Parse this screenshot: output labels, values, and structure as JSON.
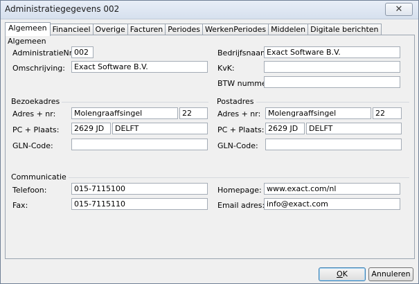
{
  "window": {
    "title": "Administratiegegevens 002",
    "close_glyph": "✕"
  },
  "tabs": [
    {
      "label": "Algemeen",
      "active": true
    },
    {
      "label": "Financieel"
    },
    {
      "label": "Overige"
    },
    {
      "label": "Facturen"
    },
    {
      "label": "Periodes"
    },
    {
      "label": "WerkenPeriodes"
    },
    {
      "label": "Middelen"
    },
    {
      "label": "Digitale berichten"
    }
  ],
  "algemeen": {
    "group_title": "Algemeen",
    "administratienr_label": "AdministratieNr:",
    "administratienr_value": "002",
    "omschrijving_label": "Omschrijving:",
    "omschrijving_value": "Exact Software B.V.",
    "bedrijfsnaam_label": "Bedrijfsnaam:",
    "bedrijfsnaam_value": "Exact Software B.V.",
    "kvk_label": "KvK:",
    "kvk_value": "",
    "btw_label": "BTW nummer:",
    "btw_value": ""
  },
  "bezoekadres": {
    "group_title": "Bezoekadres",
    "adres_label": "Adres + nr:",
    "street": "Molengraaffsingel",
    "number": "22",
    "pc_label": "PC + Plaats:",
    "postcode": "2629 JD",
    "city": "DELFT",
    "gln_label": "GLN-Code:",
    "gln_value": ""
  },
  "postadres": {
    "group_title": "Postadres",
    "adres_label": "Adres + nr:",
    "street": "Molengraaffsingel",
    "number": "22",
    "pc_label": "PC + Plaats:",
    "postcode": "2629 JD",
    "city": "DELFT",
    "gln_label": "GLN-Code:",
    "gln_value": ""
  },
  "communicatie": {
    "group_title": "Communicatie",
    "telefoon_label": "Telefoon:",
    "telefoon_value": "015-7115100",
    "fax_label": "Fax:",
    "fax_value": "015-7115110",
    "homepage_label": "Homepage:",
    "homepage_value": "www.exact.com/nl",
    "email_label": "Email adres:",
    "email_value": "info@exact.com"
  },
  "buttons": {
    "ok_mnemonic": "O",
    "ok_rest": "K",
    "cancel_label": "Annuleren"
  }
}
